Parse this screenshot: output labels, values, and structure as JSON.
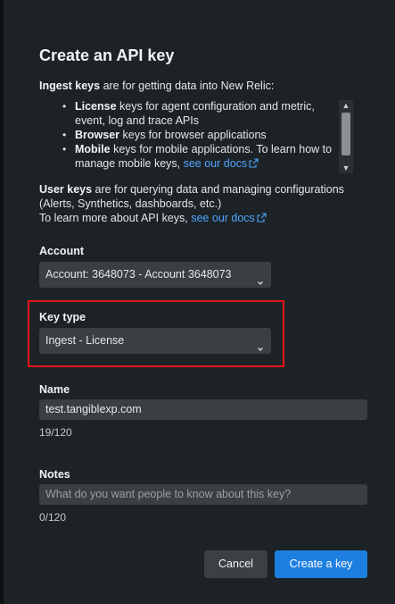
{
  "dialog": {
    "title": "Create an API key",
    "intro_bold": "Ingest keys",
    "intro_rest": " are for getting data into New Relic:",
    "bullets": [
      {
        "bold": "License",
        "text": " keys for agent configuration and metric, event, log and trace APIs"
      },
      {
        "bold": "Browser",
        "text": " keys for browser applications"
      },
      {
        "bold": "Mobile",
        "text": " keys for mobile applications. To learn how to manage mobile keys, ",
        "link": "see our docs"
      }
    ],
    "user_keys_bold": "User keys",
    "user_keys_rest": " are for querying data and managing configurations (Alerts, Synthetics, dashboards, etc.)",
    "learn_more": "To learn more about API keys, ",
    "learn_more_link": "see our docs"
  },
  "account": {
    "label": "Account",
    "value": "Account: 3648073 - Account 3648073"
  },
  "key_type": {
    "label": "Key type",
    "value": "Ingest - License"
  },
  "name": {
    "label": "Name",
    "value": "test.tangiblexp.com",
    "counter": "19/120"
  },
  "notes": {
    "label": "Notes",
    "placeholder": "What do you want people to know about this key?",
    "counter": "0/120"
  },
  "buttons": {
    "cancel": "Cancel",
    "create": "Create a key"
  },
  "colors": {
    "panel": "#1d2226",
    "field": "#3a3f44",
    "link": "#4fa5ff",
    "primary": "#1d7fe0",
    "highlight": "#e3141b"
  }
}
